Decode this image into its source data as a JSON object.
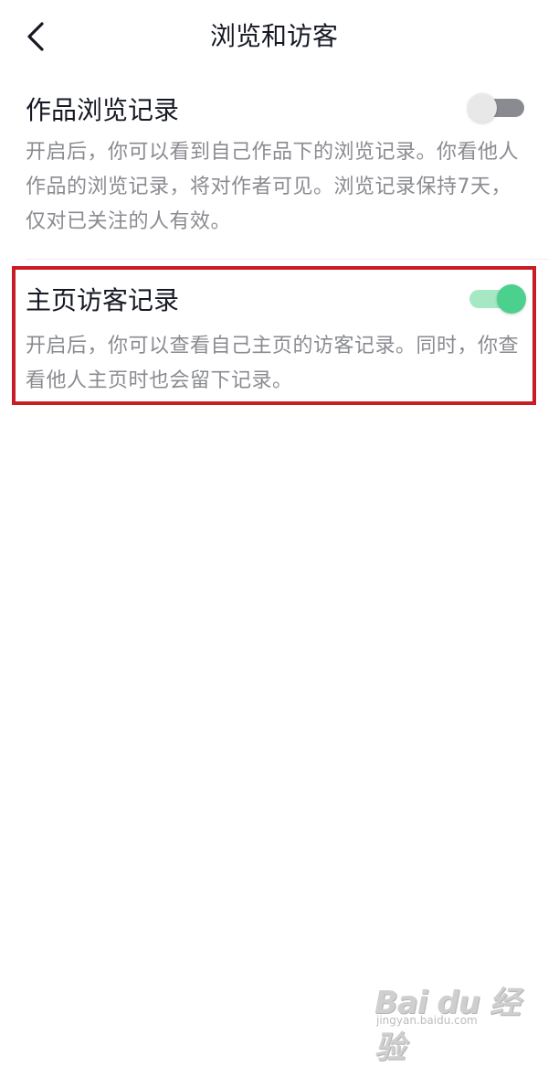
{
  "header": {
    "title": "浏览和访客",
    "back_icon": "chevron-left-icon"
  },
  "settings": [
    {
      "title": "作品浏览记录",
      "enabled": false,
      "description": "开启后，你可以看到自己作品下的浏览记录。你看他人作品的浏览记录，将对作者可见。浏览记录保持7天，仅对已关注的人有效。"
    },
    {
      "title": "主页访客记录",
      "enabled": true,
      "description": "开启后，你可以查看自己主页的访客记录。同时，你查看他人主页时也会留下记录。"
    }
  ],
  "colors": {
    "toggle_on": "#4cd08e",
    "toggle_off": "#8a8b91",
    "highlight": "#c81d25",
    "description_text": "#8a8b91"
  },
  "watermark": {
    "logo": "Bai du 经验",
    "url": "jingyan.baidu.com"
  }
}
